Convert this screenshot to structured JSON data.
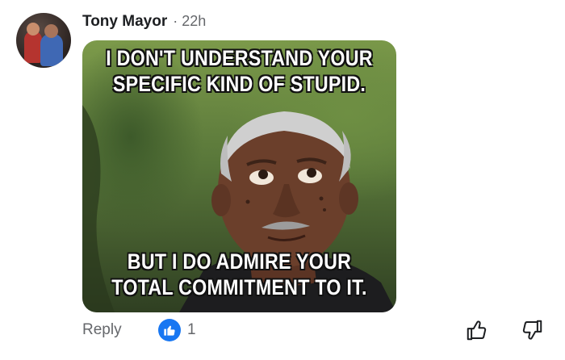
{
  "comment": {
    "author": "Tony Mayor",
    "separator": "·",
    "timestamp": "22h",
    "meme": {
      "top_text": "I DON'T UNDERSTAND YOUR SPECIFIC KIND OF STUPID.",
      "top_line1": "I DON'T UNDERSTAND YOUR",
      "top_line2": "SPECIFIC KIND OF STUPID.",
      "bottom_line1": "BUT I DO ADMIRE YOUR",
      "bottom_line2": "TOTAL COMMITMENT TO IT."
    },
    "actions": {
      "reply_label": "Reply",
      "reaction_icon": "thumbs-up-icon",
      "reaction_count": "1",
      "upvote_icon": "thumbs-up-outline-icon",
      "downvote_icon": "thumbs-down-outline-icon"
    }
  },
  "colors": {
    "accent": "#1877f2",
    "secondary_text": "#65676b",
    "primary_text": "#1c1e21"
  }
}
